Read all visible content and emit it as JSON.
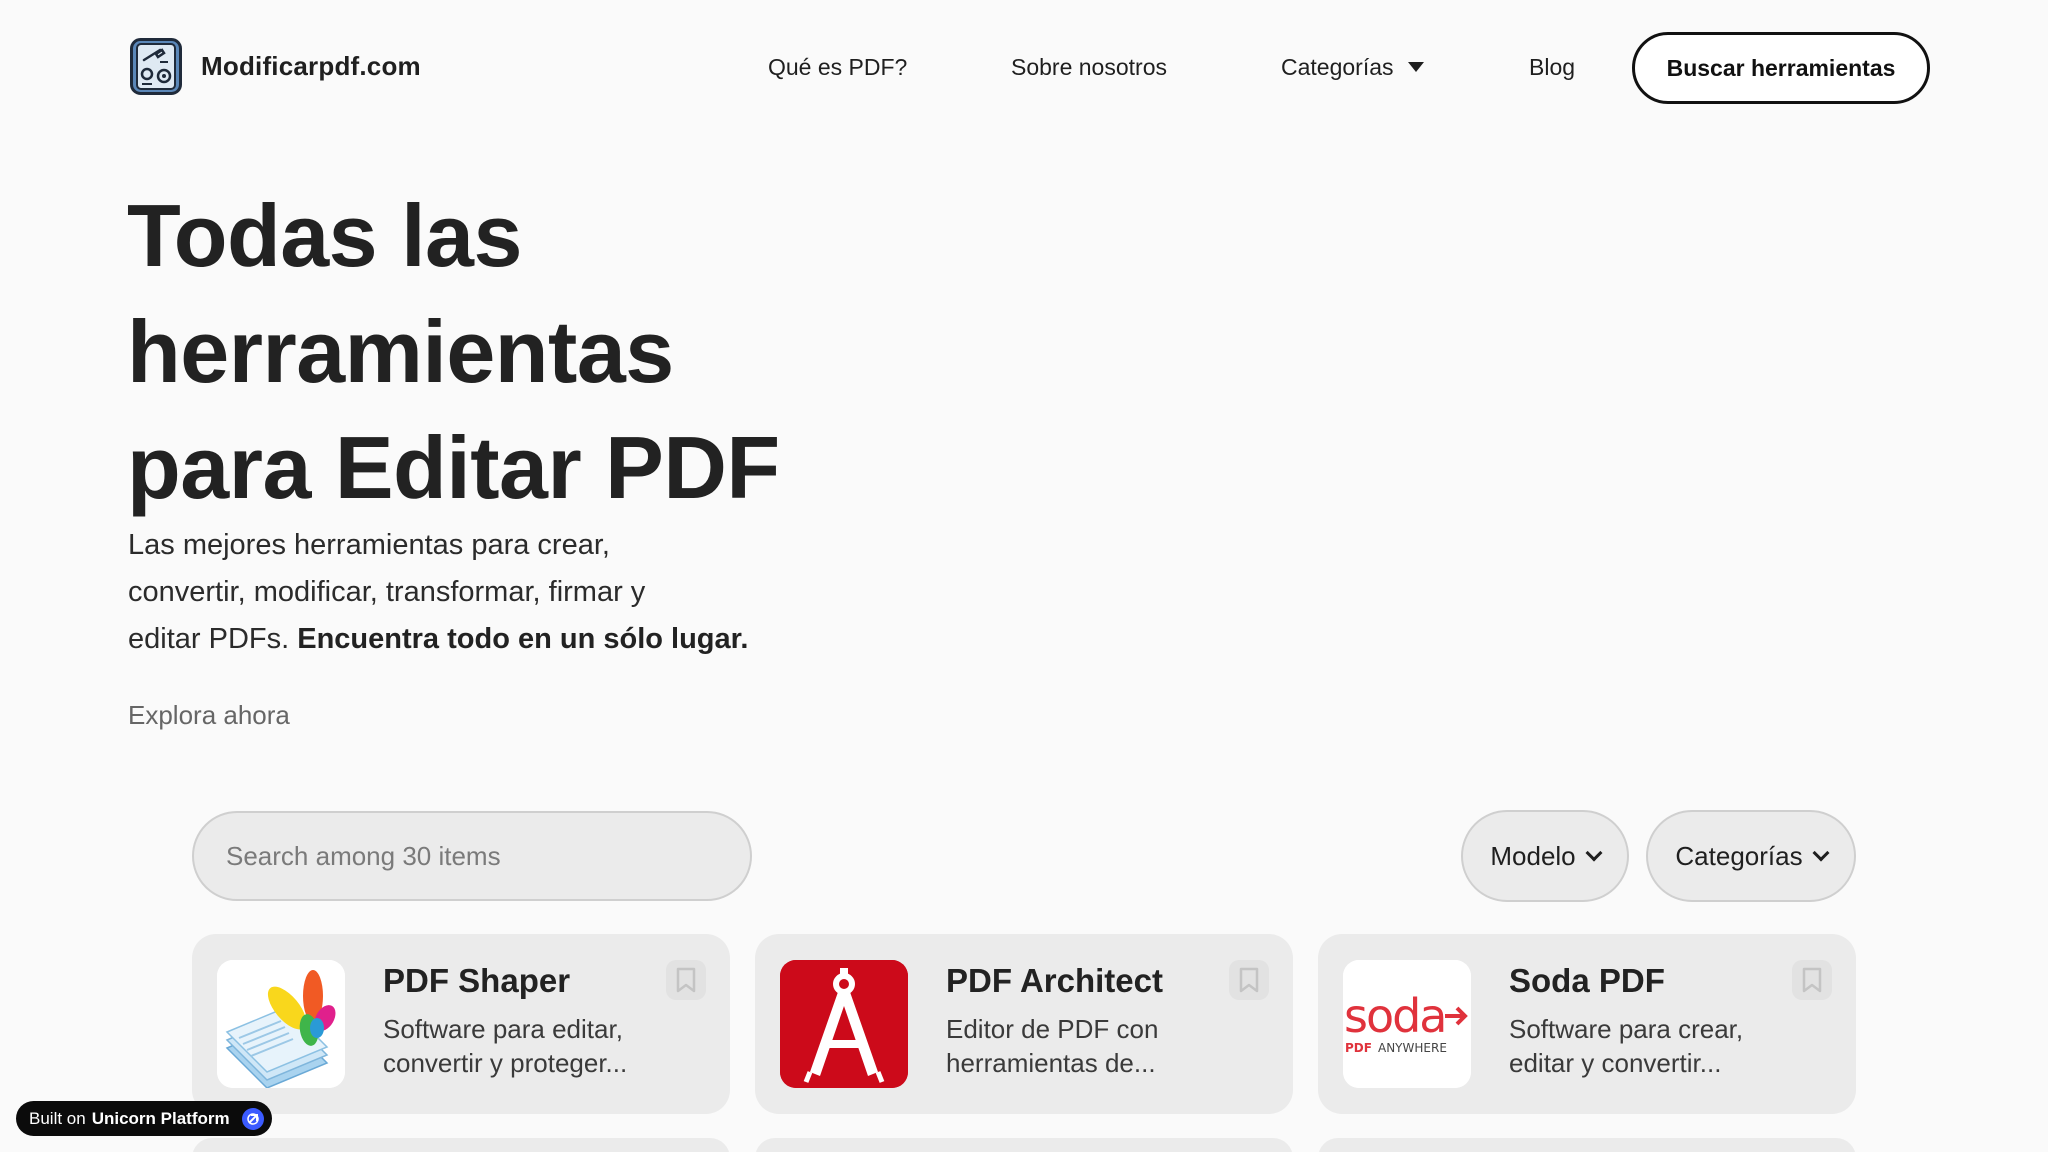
{
  "header": {
    "logo_text": "Modificarpdf.com",
    "nav": {
      "what_is_pdf": "Qué es PDF?",
      "about_us": "Sobre nosotros",
      "categories": "Categorías",
      "blog": "Blog"
    },
    "cta_label": "Buscar herramientas"
  },
  "hero": {
    "title_line1": "Todas las",
    "title_line2": "herramientas",
    "title_line3": "para Editar PDF",
    "subtitle_line1": "Las mejores herramientas para crear,",
    "subtitle_line2": "convertir, modificar, transformar, firmar y",
    "subtitle_line3_plain": "editar PDFs.",
    "subtitle_line3_bold": "Encuentra todo en un sólo lugar.",
    "explore_label": "Explora ahora"
  },
  "filters": {
    "search_placeholder": "Search among 30 items",
    "model_label": "Modelo",
    "categories_label": "Categorías"
  },
  "cards": [
    {
      "title": "PDF Shaper",
      "desc_line1": "Software para editar,",
      "desc_line2": "convertir y proteger...",
      "logo": "pdf-shaper-logo"
    },
    {
      "title": "PDF Architect",
      "desc_line1": "Editor de PDF con",
      "desc_line2": "herramientas de...",
      "logo": "pdf-architect-logo"
    },
    {
      "title": "Soda PDF",
      "desc_line1": "Software para crear,",
      "desc_line2": "editar y convertir...",
      "logo": "soda-pdf-logo",
      "logo_text": "soda",
      "logo_subtext_red": "PDF",
      "logo_subtext": "ANYWHERE"
    }
  ],
  "badge": {
    "prefix": "Built on",
    "brand": "Unicorn Platform"
  },
  "colors": {
    "background": "#fafafa",
    "card_bg": "#ebebeb",
    "text": "#1f1f1f",
    "architect_red": "#cc0a1a",
    "soda_red": "#e0323c",
    "badge_blue": "#3b5bff"
  }
}
